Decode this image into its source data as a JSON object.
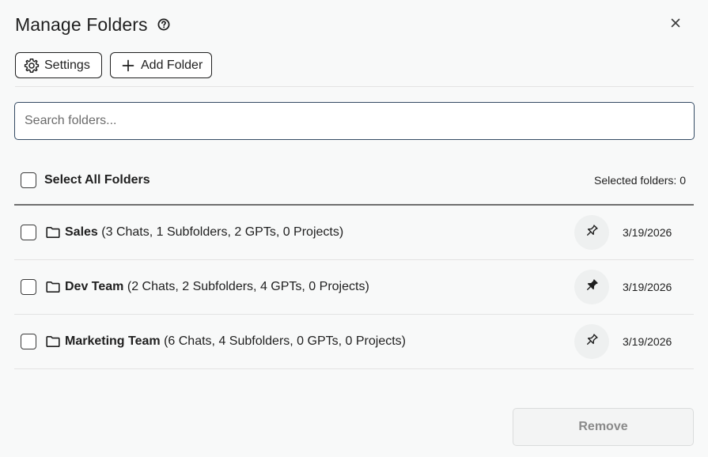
{
  "dialog": {
    "title": "Manage Folders",
    "help_icon": "help-circle-icon",
    "close_icon": "close-icon"
  },
  "toolbar": {
    "settings_label": "Settings",
    "settings_icon": "gear-icon",
    "add_folder_label": "Add Folder",
    "add_folder_icon": "plus-icon"
  },
  "search": {
    "placeholder": "Search folders...",
    "value": ""
  },
  "select_all": {
    "label": "Select All Folders",
    "checked": false,
    "selected_count_text": "Selected folders: 0"
  },
  "folders": [
    {
      "name": "Sales",
      "details": "(3 Chats, 1 Subfolders, 2 GPTs, 0 Projects)",
      "date": "3/19/2026",
      "pinned": false,
      "checked": false
    },
    {
      "name": "Dev Team",
      "details": "(2 Chats, 2 Subfolders, 4 GPTs, 0 Projects)",
      "date": "3/19/2026",
      "pinned": true,
      "checked": false
    },
    {
      "name": "Marketing Team",
      "details": "(6 Chats, 4 Subfolders, 0 GPTs, 0 Projects)",
      "date": "3/19/2026",
      "pinned": false,
      "checked": false
    }
  ],
  "footer": {
    "remove_label": "Remove",
    "remove_enabled": false
  }
}
